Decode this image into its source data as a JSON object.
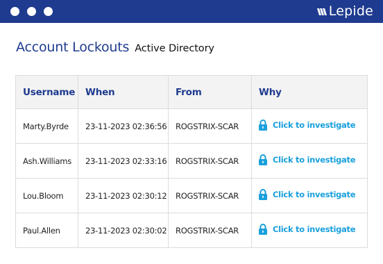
{
  "brand": {
    "name": "Lepide",
    "bar_color": "#1f3b8f",
    "logo_icon": "lepide-logo-mark-icon"
  },
  "window": {
    "controls": [
      "window-dot-1",
      "window-dot-2",
      "window-dot-3"
    ]
  },
  "heading": {
    "title": "Account Lockouts",
    "subtitle": "Active Directory"
  },
  "table": {
    "columns": [
      "Username",
      "When",
      "From",
      "Why"
    ],
    "rows": [
      {
        "username": "Marty.Byrde",
        "when": "23-11-2023 02:36:56",
        "from": "ROGSTRIX-SCAR",
        "why": "Click to investigate"
      },
      {
        "username": "Ash.Williams",
        "when": "23-11-2023 02:33:16",
        "from": "ROGSTRIX-SCAR",
        "why": "Click to investigate"
      },
      {
        "username": "Lou.Bloom",
        "when": "23-11-2023 02:30:12",
        "from": "ROGSTRIX-SCAR",
        "why": "Click to investigate"
      },
      {
        "username": "Paul.Allen",
        "when": "23-11-2023 02:30:02",
        "from": "ROGSTRIX-SCAR",
        "why": "Click to investigate"
      }
    ],
    "header_color": "#1f3b8f",
    "link_color": "#1aa0dc",
    "why_icon": "lock-icon"
  }
}
